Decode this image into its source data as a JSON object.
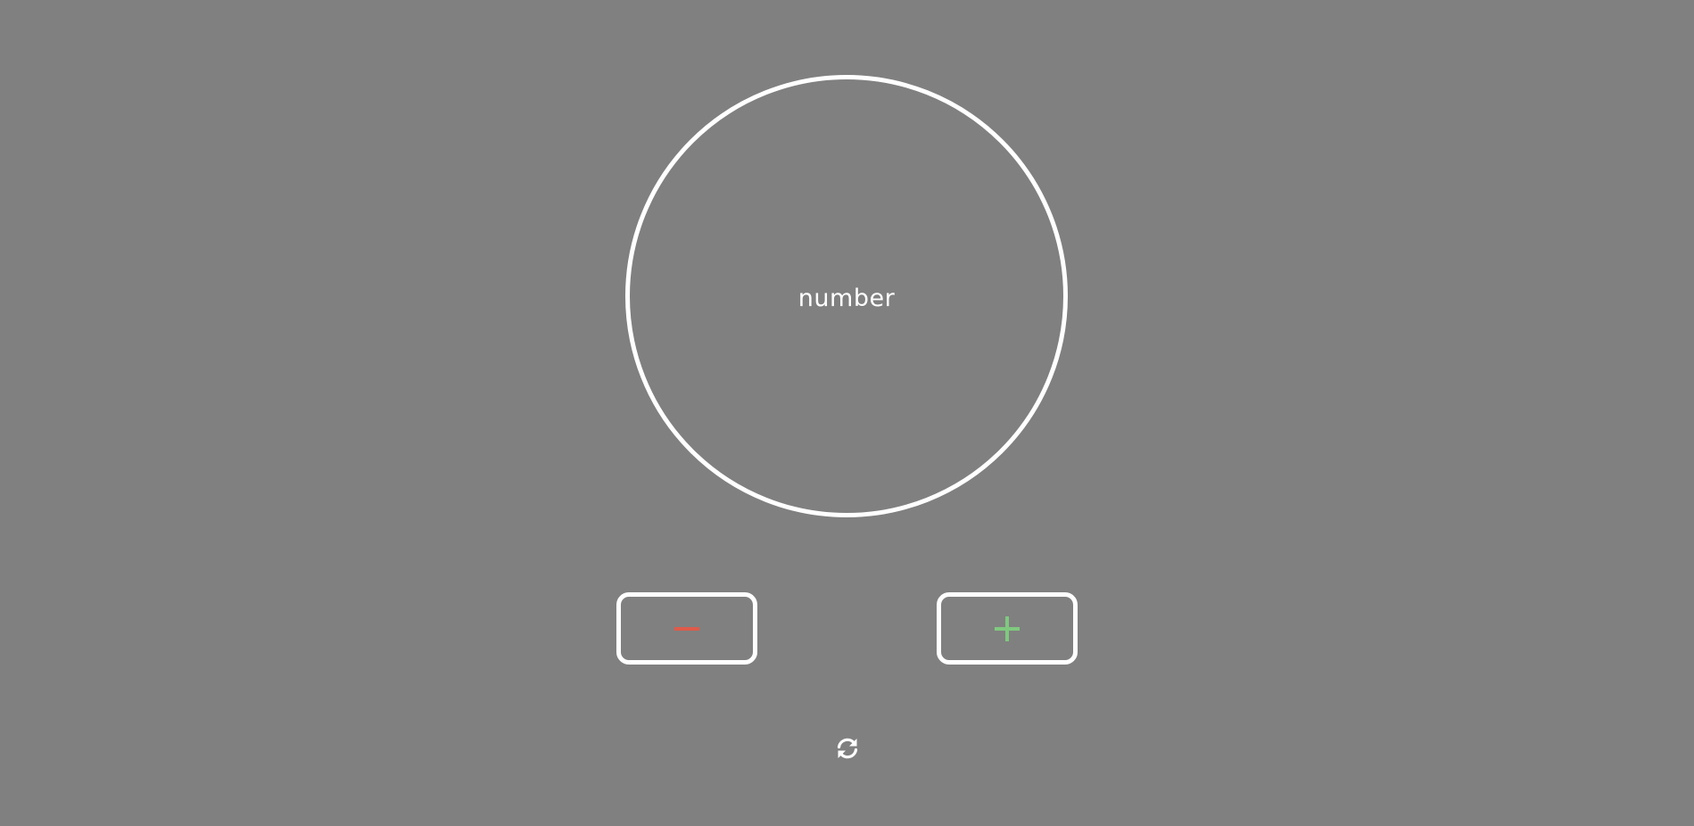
{
  "counter": {
    "value": "number"
  },
  "controls": {
    "decrement": {
      "icon": "minus-icon",
      "color": "#e05a4a"
    },
    "increment": {
      "icon": "plus-icon",
      "color": "#7fc97f"
    },
    "reset": {
      "icon": "refresh-icon",
      "color": "#ffffff"
    }
  },
  "theme": {
    "background": "#808080",
    "outline": "#ffffff"
  }
}
